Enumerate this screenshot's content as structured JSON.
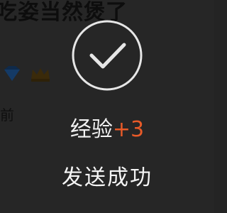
{
  "background_page": {
    "title_fragment": "吃姿当然煲了",
    "time_fragment": "前",
    "badges": [
      {
        "icon": "diamond-icon"
      },
      {
        "icon": "crown-icon"
      }
    ]
  },
  "toast": {
    "icon": "check-circle-icon",
    "exp_label": "经验",
    "exp_value": "+3",
    "message": "发送成功",
    "colors": {
      "exp_value": "#e85a28",
      "text": "#f5f5f5",
      "icon_stroke": "#e6e6e6"
    }
  }
}
